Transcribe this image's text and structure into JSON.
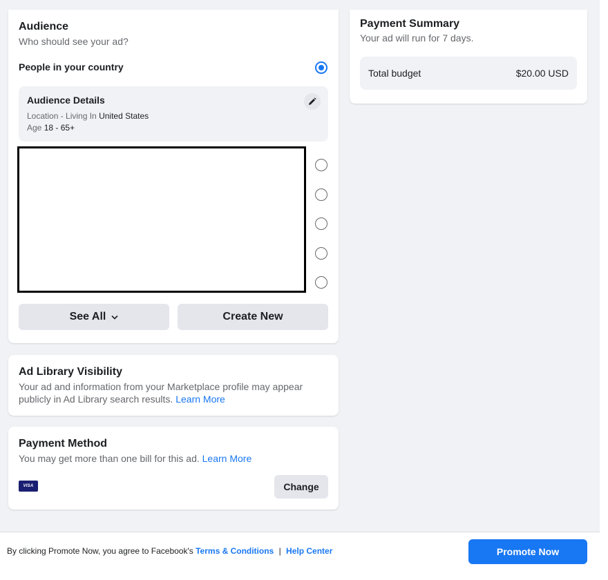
{
  "audience": {
    "title": "Audience",
    "subtitle": "Who should see your ad?",
    "option_label": "People in your country",
    "details": {
      "title": "Audience Details",
      "location_prefix": "Location - Living In",
      "location_value": "United States",
      "age_prefix": "Age",
      "age_value": "18 - 65+"
    },
    "see_all_label": "See All",
    "create_new_label": "Create New"
  },
  "summary": {
    "title": "Payment Summary",
    "subtitle": "Your ad will run for 7 days.",
    "budget_label": "Total budget",
    "budget_value": "$20.00 USD"
  },
  "ad_library": {
    "title": "Ad Library Visibility",
    "text": "Your ad and information from your Marketplace profile may appear publicly in Ad Library search results.",
    "learn_more": "Learn More"
  },
  "payment": {
    "title": "Payment Method",
    "text": "You may get more than one bill for this ad.",
    "learn_more": "Learn More",
    "card_brand": "VISA",
    "change_label": "Change"
  },
  "footer": {
    "terms_prefix": "By clicking Promote Now, you agree to Facebook's",
    "terms_link": "Terms & Conditions",
    "separator": "|",
    "help_link": "Help Center",
    "promote_label": "Promote Now"
  },
  "colors": {
    "accent": "#1877f2",
    "background": "#f0f2f5"
  }
}
